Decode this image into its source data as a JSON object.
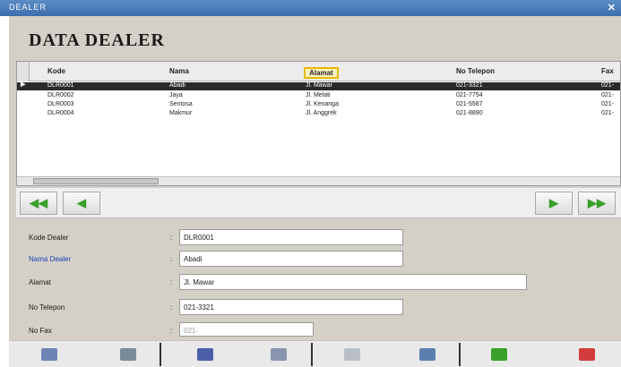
{
  "window": {
    "title": "DEALER",
    "close_glyph": "✕"
  },
  "page": {
    "heading": "DATA DEALER"
  },
  "grid": {
    "columns": [
      "Kode",
      "Nama",
      "Alamat",
      "No Telepon",
      "Fax"
    ],
    "selected_column": "Alamat",
    "rows": [
      {
        "marker": "▶",
        "kode": "DLR0001",
        "nama": "Abadi",
        "alamat": "Jl. Mawar",
        "telepon": "021-3321",
        "fax": "021-"
      },
      {
        "marker": "",
        "kode": "DLR0002",
        "nama": "Jaya",
        "alamat": "Jl. Melati",
        "telepon": "021-7754",
        "fax": "021-"
      },
      {
        "marker": "",
        "kode": "DLR0003",
        "nama": "Sentosa",
        "alamat": "Jl. Kenanga",
        "telepon": "021-5587",
        "fax": "021-"
      },
      {
        "marker": "",
        "kode": "DLR0004",
        "nama": "Makmur",
        "alamat": "Jl. Anggrek",
        "telepon": "021-8890",
        "fax": "021-"
      }
    ]
  },
  "nav": {
    "first": "◀◀",
    "prev": "◀",
    "next": "▶",
    "last": "▶▶"
  },
  "form": {
    "fields": [
      {
        "label": "Kode Dealer",
        "value": "DLR0001"
      },
      {
        "label": "Nama Dealer",
        "value": "Abadi"
      },
      {
        "label": "Alamat",
        "value": "Jl. Mawar"
      },
      {
        "label": "No Telepon",
        "value": "021-3321"
      },
      {
        "label": "No Fax",
        "value": "021-"
      }
    ]
  },
  "toolbar": {
    "icons": [
      "new-icon",
      "copy-icon",
      "edit-icon",
      "save-icon",
      "undo-icon",
      "print-icon",
      "refresh-icon",
      "exit-icon"
    ]
  }
}
